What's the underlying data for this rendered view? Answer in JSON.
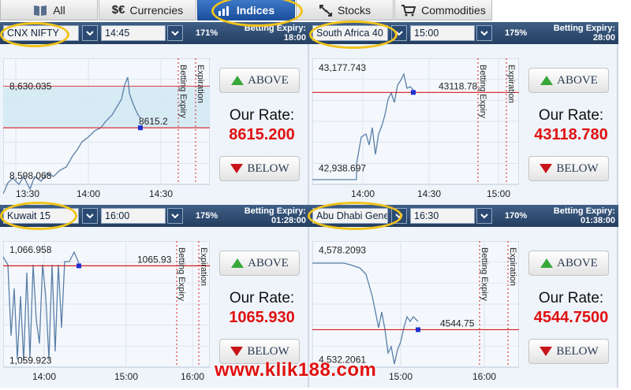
{
  "tabs": [
    {
      "label": "All",
      "icon": "book-icon"
    },
    {
      "label": "Currencies",
      "icon": "currency-icon",
      "symbol": "$€"
    },
    {
      "label": "Indices",
      "icon": "bar-chart-icon",
      "active": true
    },
    {
      "label": "Stocks",
      "icon": "stock-icon"
    },
    {
      "label": "Commodities",
      "icon": "cart-icon"
    }
  ],
  "common": {
    "betting_expiry": "Betting Expiry:",
    "above": "ABOVE",
    "below": "BELOW",
    "our_rate": "Our Rate:",
    "betting_expiry_line": "Betting Expiry",
    "expiration_line": "Expiration"
  },
  "panels": [
    {
      "asset": "CNX NIFTY",
      "time": "14:45",
      "payout": "171%",
      "expiry": "18:00",
      "rate": "8615.200",
      "chart_data": {
        "type": "line",
        "y_top_label": "8,630.035",
        "y_bottom_label": "8,598.068",
        "current_label": "8615.2",
        "x_ticks": [
          "13:30",
          "14:00",
          "14:30"
        ],
        "ylim": [
          8595,
          8640
        ],
        "shaded_range": [
          8615.2,
          8630.035
        ]
      }
    },
    {
      "asset": "South Africa 40",
      "time": "15:00",
      "payout": "175%",
      "expiry": "28:00",
      "rate": "43118.780",
      "chart_data": {
        "type": "line",
        "y_top_label": "43,177.743",
        "y_bottom_label": "42,938.697",
        "current_label": "43118.78",
        "x_ticks": [
          "14:00",
          "14:30",
          "15:00"
        ],
        "ylim": [
          42900,
          43200
        ]
      }
    },
    {
      "asset": "Kuwait 15",
      "time": "16:00",
      "payout": "175%",
      "expiry": "01:28:00",
      "rate": "1065.930",
      "chart_data": {
        "type": "line",
        "y_top_label": "1,066.958",
        "y_bottom_label": "1,059.923",
        "current_label": "1065.93",
        "x_ticks": [
          "14:00",
          "15:00",
          "16:00"
        ],
        "ylim": [
          1059.5,
          1067.5
        ]
      }
    },
    {
      "asset": "Abu Dhabi Gene",
      "time": "16:30",
      "payout": "170%",
      "expiry": "01:38:00",
      "rate": "4544.7500",
      "chart_data": {
        "type": "line",
        "y_top_label": "4,578.2093",
        "y_bottom_label": "4,532.2061",
        "current_label": "4544.75",
        "x_ticks": [
          "15:00",
          "16:00"
        ],
        "ylim": [
          4529,
          4582
        ]
      }
    }
  ],
  "watermark": "www.klik188.com",
  "colors": {
    "rate": "#e01010",
    "highlight_oval": "#f2c31a",
    "header": "#2c4a70",
    "active_tab": "#2a62b4"
  }
}
